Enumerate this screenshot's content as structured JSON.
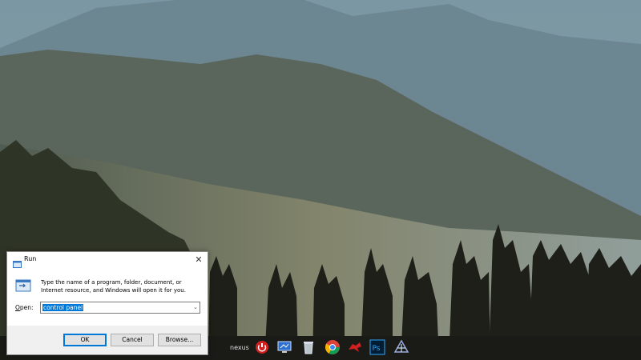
{
  "dialog": {
    "title": "Run",
    "description": "Type the name of a program, folder, document, or Internet resource, and Windows will open it for you.",
    "open_label_underlined": "O",
    "open_label_rest": "pen:",
    "input_value": "control panel",
    "ok_label": "OK",
    "cancel_label": "Cancel",
    "browse_label": "Browse...",
    "close_glyph": "✕"
  },
  "taskbar": {
    "icons": [
      "nexus-icon",
      "power-icon",
      "monitor-icon",
      "recycle-bin-icon",
      "chrome-icon",
      "msi-dragon-icon",
      "photoshop-icon",
      "network-icon"
    ],
    "nexus_label": "nexus",
    "photoshop_label": "Ps"
  },
  "colors": {
    "selection": "#0078d7",
    "dialog_footer": "#f0f0f0",
    "accent_red": "#d0201f"
  }
}
